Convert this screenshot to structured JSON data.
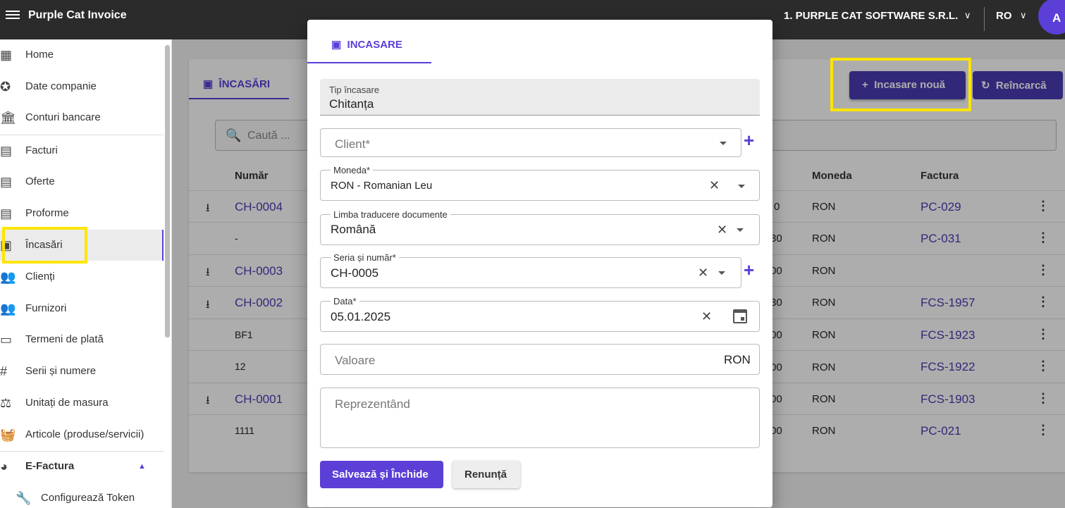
{
  "app": {
    "title": "Purple Cat Invoice",
    "company": "1. PURPLE CAT SOFTWARE S.R.L.",
    "language": "RO",
    "avatar_letter": "A"
  },
  "sidebar": {
    "items": [
      {
        "label": "Home"
      },
      {
        "label": "Date companie"
      },
      {
        "label": "Conturi bancare"
      },
      {
        "label": "Facturi"
      },
      {
        "label": "Oferte"
      },
      {
        "label": "Proforme"
      },
      {
        "label": "Încasări"
      },
      {
        "label": "Clienți"
      },
      {
        "label": "Furnizori"
      },
      {
        "label": "Termeni de plată"
      },
      {
        "label": "Serii și numere"
      },
      {
        "label": "Unitați de masura"
      },
      {
        "label": "Articole (produse/servicii)"
      },
      {
        "label": "E-Factura"
      },
      {
        "label": "Configurează Token"
      }
    ]
  },
  "page": {
    "tab": "ÎNCASĂRI",
    "search_placeholder": "Caută ...",
    "new_button": "Incasare nouă",
    "reload_button": "Reîncarcă",
    "headers": {
      "number": "Număr",
      "currency": "Moneda",
      "invoice": "Factura"
    },
    "rows": [
      {
        "number": "CH-0004",
        "value_tail": "0",
        "currency": "RON",
        "invoice": "PC-029"
      },
      {
        "number": "-",
        "value_tail": "30",
        "currency": "RON",
        "invoice": "PC-031"
      },
      {
        "number": "CH-0003",
        "value_tail": "00",
        "currency": "RON",
        "invoice": ""
      },
      {
        "number": "CH-0002",
        "value_tail": "30",
        "currency": "RON",
        "invoice": "FCS-1957"
      },
      {
        "number": "BF1",
        "value_tail": "00",
        "currency": "RON",
        "invoice": "FCS-1923"
      },
      {
        "number": "12",
        "value_tail": "00",
        "currency": "RON",
        "invoice": "FCS-1922"
      },
      {
        "number": "CH-0001",
        "value_tail": "00",
        "currency": "RON",
        "invoice": "FCS-1903"
      },
      {
        "number": "1111",
        "value_tail": "00",
        "currency": "RON",
        "invoice": "PC-021"
      }
    ]
  },
  "dialog": {
    "tab": "INCASARE",
    "type_label": "Tip încasare",
    "type_value": "Chitanța",
    "client_placeholder": "Client*",
    "currency_label": "Moneda*",
    "currency_value": "RON - Romanian Leu",
    "translation_label": "Limba traducere documente",
    "translation_value": "Română",
    "series_label": "Seria și număr*",
    "series_value": "CH-0005",
    "date_label": "Data*",
    "date_value": "05.01.2025",
    "amount_placeholder": "Valoare",
    "amount_suffix": "RON",
    "representing_placeholder": "Reprezentând",
    "save_button": "Salvează și Închide",
    "cancel_button": "Renunță"
  },
  "colors": {
    "accent": "#5b3fd6",
    "topbar": "#2b2b2b",
    "highlight": "#ffe500"
  }
}
